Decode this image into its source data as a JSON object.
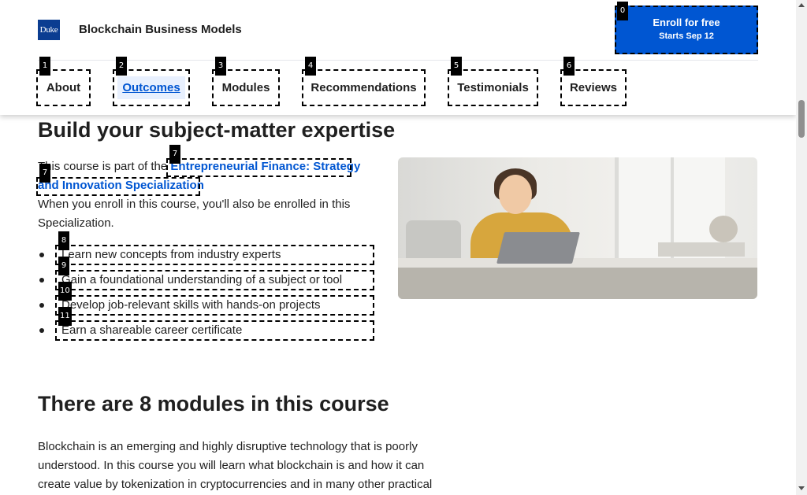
{
  "header": {
    "logo_text": "Duke",
    "course_title": "Blockchain Business Models",
    "enroll_label": "Enroll for free",
    "enroll_sub": "Starts Sep 12"
  },
  "tabs": [
    {
      "label": "About"
    },
    {
      "label": "Outcomes",
      "active": true
    },
    {
      "label": "Modules"
    },
    {
      "label": "Recommendations"
    },
    {
      "label": "Testimonials"
    },
    {
      "label": "Reviews"
    }
  ],
  "badges": [
    "0",
    "1",
    "2",
    "3",
    "4",
    "5",
    "6",
    "7",
    "7",
    "8",
    "9",
    "10",
    "11"
  ],
  "outcomes": {
    "heading": "Build your subject-matter expertise",
    "intro_prefix": "This course is part of the ",
    "spec_link_line1": "Entrepreneurial Finance: Strategy",
    "spec_link_line2": "and Innovation Specialization",
    "enroll_note_line1": "When you enroll in this course, you'll also be enrolled in this",
    "enroll_note_line2": "Specialization.",
    "bullets": [
      "Learn new concepts from industry experts",
      "Gain a foundational understanding of a subject or tool",
      "Develop job-relevant skills with hands-on projects",
      "Earn a shareable career certificate"
    ]
  },
  "modules": {
    "heading": "There are 8 modules in this course",
    "desc_line1": "Blockchain is an emerging and highly disruptive technology that is poorly",
    "desc_line2": "understood. In this course you will learn what blockchain is and how it can",
    "desc_line3": "create value by tokenization in cryptocurrencies and in many other practical"
  },
  "colors": {
    "accent": "#0056d2",
    "logo_bg": "#0b3d91",
    "text": "#1f1f1f"
  },
  "icons": {
    "scroll_up": "scroll-up-arrow-icon",
    "scroll_down": "scroll-down-arrow-icon"
  }
}
